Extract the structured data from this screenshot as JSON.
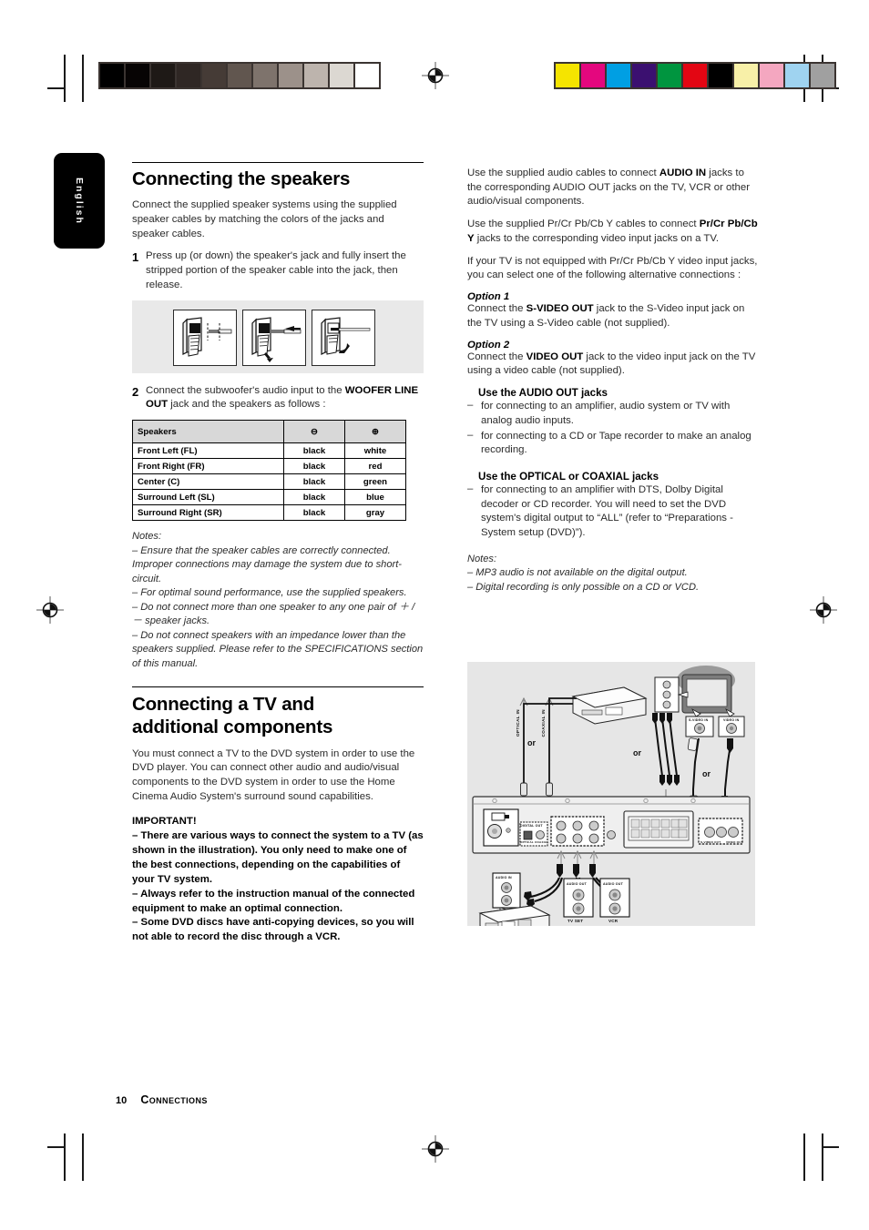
{
  "page": {
    "language_tab": "English",
    "footer_page_number": "10",
    "footer_section": "Connections"
  },
  "color_bars": {
    "grayscale": [
      "#000000",
      "#070404",
      "#1e1916",
      "#2f2724",
      "#453b36",
      "#61564f",
      "#7e736c",
      "#9c918a",
      "#bdb4ad",
      "#dcd8d2",
      "#ffffff"
    ],
    "colors": [
      "#f5e400",
      "#e4077e",
      "#009fe3",
      "#3b1070",
      "#00953f",
      "#e30613",
      "#000000",
      "#f8f0a8",
      "#f4a7c0",
      "#9fd3f0",
      "#a0a0a0"
    ]
  },
  "left_column": {
    "heading1": "Connecting the speakers",
    "intro": "Connect the supplied speaker systems using the supplied speaker cables by matching the colors of the jacks and speaker cables.",
    "step1": {
      "num": "1",
      "text": "Press up (or down) the speaker's jack and fully insert the stripped portion of the speaker cable into the jack, then release."
    },
    "step2": {
      "num": "2",
      "text_a": "Connect the subwoofer's audio input to the ",
      "bold_a": "WOOFER LINE OUT",
      "text_b": " jack and the speakers as follows :"
    },
    "table": {
      "headers": [
        "Speakers",
        "⊖",
        "⊕"
      ],
      "rows": [
        [
          "Front Left (FL)",
          "black",
          "white"
        ],
        [
          "Front Right (FR)",
          "black",
          "red"
        ],
        [
          "Center (C)",
          "black",
          "green"
        ],
        [
          "Surround Left (SL)",
          "black",
          "blue"
        ],
        [
          "Surround Right (SR)",
          "black",
          "gray"
        ]
      ]
    },
    "notes_label": "Notes:",
    "notes": [
      "–  Ensure that the speaker cables are correctly connected. Improper connections may damage the system due to short-circuit.",
      "–  For optimal sound performance, use the supplied speakers.",
      "–  Do not connect more than one speaker to any one pair of ＋ / －  speaker jacks.",
      "–  Do not connect speakers with an impedance lower than the speakers supplied.  Please refer to the SPECIFICATIONS section of this manual."
    ],
    "heading2_line1": "Connecting a TV and",
    "heading2_line2": "additional components",
    "intro2": "You must connect a TV to the DVD system in order to use the DVD player. You can connect other audio and audio/visual components to the DVD system in order to use the Home Cinema Audio System's surround sound capabilities.",
    "important_label": "IMPORTANT!",
    "important_items": [
      "–  There are various ways to connect the system to a TV (as shown in the illustration). You only need to make one of the best connections, depending on the capabilities of your TV system.",
      "–  Always refer to the instruction manual of the connected equipment to make an optimal connection.",
      "–  Some DVD discs have anti-copying devices, so you will not able to record the disc through a VCR."
    ]
  },
  "right_column": {
    "para1_a": "Use the supplied audio cables to connect ",
    "para1_bold": "AUDIO IN",
    "para1_b": " jacks to the corresponding AUDIO OUT jacks on the TV, VCR or other audio/visual components.",
    "para2_a": "Use the supplied Pr/Cr Pb/Cb Y cables to connect ",
    "para2_bold": "Pr/Cr Pb/Cb Y",
    "para2_b": " jacks to the corresponding video input jacks on a TV.",
    "para3": "If your TV is not equipped with Pr/Cr Pb/Cb Y video input jacks, you can select one of the following alternative connections :",
    "option1_label": "Option 1",
    "option1_a": "Connect the ",
    "option1_bold": "S-VIDEO OUT",
    "option1_b": " jack to the S-Video input jack on the TV using a S-Video cable (not supplied).",
    "option2_label": "Option 2",
    "option2_a": "Connect the ",
    "option2_bold": "VIDEO OUT",
    "option2_b": " jack to the video input jack on the TV using a video cable (not supplied).",
    "audio_out_heading_a": "Use the ",
    "audio_out_heading_bold": "AUDIO OUT",
    "audio_out_heading_b": " jacks",
    "audio_out_items": [
      "for connecting to an amplifier, audio system or TV with analog audio inputs.",
      "for connecting to a CD or Tape recorder to make an analog recording."
    ],
    "optical_heading_a": "Use the ",
    "optical_heading_bold": "OPTICAL or COAXIAL",
    "optical_heading_b": " jacks",
    "optical_items": [
      "for connecting to an amplifier with DTS, Dolby Digital decoder or CD recorder. You will need to set the DVD system's digital output to “ALL” (refer to “Preparations - System setup (DVD)”)."
    ],
    "notes_label": "Notes:",
    "notes": [
      "–  MP3 audio is not available on the digital output.",
      "–  Digital recording is only possible on a CD or VCD."
    ]
  },
  "diagram": {
    "labels": {
      "optical_in": "OPTICAL IN",
      "coaxial_in": "COAXIAL IN",
      "or1": "or",
      "or2": "or",
      "or3": "or",
      "s_video_in": "S-VIDEO IN",
      "video_in": "VIDEO IN",
      "audio_in": "AUDIO IN",
      "audio_out_tv": "AUDIO OUT",
      "audio_out_vcr": "AUDIO OUT",
      "tv_set": "TV SET",
      "vcr": "VCR",
      "s_video_out": "S-VIDEO OUT",
      "video_out": "VIDEO OUT",
      "digital_out": "DIGITAL OUT",
      "optical_coaxial": "OPTICAL COAXIAL"
    }
  }
}
